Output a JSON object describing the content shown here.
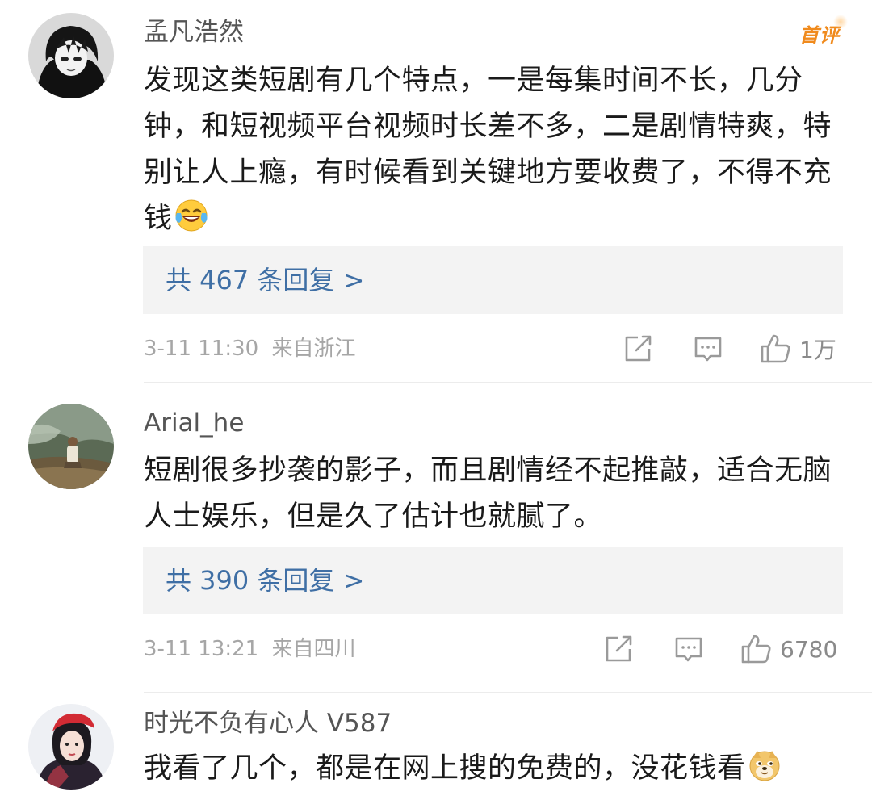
{
  "comments": [
    {
      "username": "孟凡浩然",
      "badge": "首评",
      "text": "发现这类短剧有几个特点，一是每集时间不长，几分钟，和短视频平台视频时长差不多，二是剧情特爽，特别让人上瘾，有时候看到关键地方要收费了，不得不充钱",
      "emoji": "laugh-cry-emoji",
      "replies_label": "共 467 条回复 >",
      "time": "3-11 11:30",
      "location": "来自浙江",
      "likes": "1万"
    },
    {
      "username": "Arial_he",
      "text": "短剧很多抄袭的影子，而且剧情经不起推敲，适合无脑人士娱乐，但是久了估计也就腻了。",
      "replies_label": "共 390 条回复 >",
      "time": "3-11 13:21",
      "location": "来自四川",
      "likes": "6780"
    },
    {
      "username": "时光不负有心人 V587",
      "text": "我看了几个，都是在网上搜的免费的，没花钱看",
      "emoji": "doge-emoji"
    }
  ],
  "colors": {
    "link": "#3f6fa5",
    "meta": "#a6a6a6",
    "badge": "#f08a1c",
    "reply_bg": "#f3f3f3"
  }
}
